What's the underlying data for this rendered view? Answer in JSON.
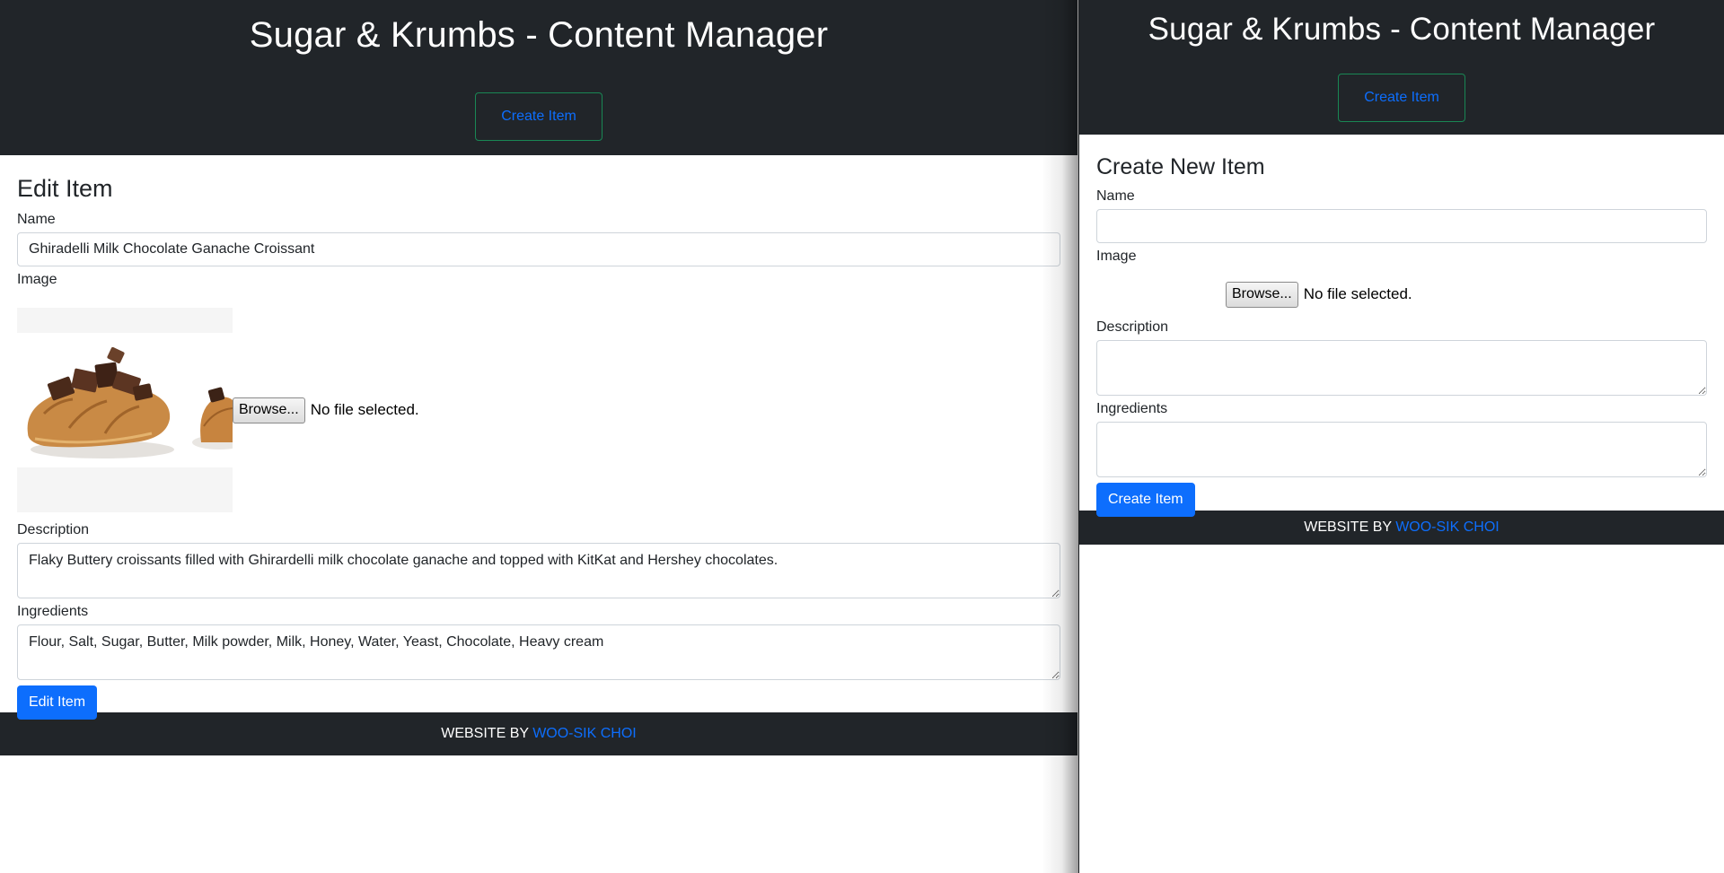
{
  "edit_window": {
    "title": "Sugar & Krumbs - Content Manager",
    "nav_button": "Create Item",
    "heading": "Edit Item",
    "name_label": "Name",
    "name_value": "Ghiradelli Milk Chocolate Ganache Croissant",
    "image_label": "Image",
    "image_description": "Croissant topped with chocolate pieces",
    "browse_label": "Browse...",
    "file_status": "No file selected.",
    "description_label": "Description",
    "description_value": "Flaky Buttery croissants filled with Ghirardelli milk chocolate ganache and topped with KitKat and Hershey chocolates.",
    "ingredients_label": "Ingredients",
    "ingredients_value": "Flour, Salt, Sugar, Butter, Milk powder, Milk, Honey, Water, Yeast, Chocolate, Heavy cream",
    "submit_label": "Edit Item",
    "footer_prefix": "WEBSITE BY",
    "footer_link": "WOO-SIK CHOI"
  },
  "create_window": {
    "title": "Sugar & Krumbs - Content Manager",
    "nav_button": "Create Item",
    "heading": "Create New Item",
    "name_label": "Name",
    "name_value": "",
    "image_label": "Image",
    "browse_label": "Browse...",
    "file_status": "No file selected.",
    "description_label": "Description",
    "description_value": "",
    "ingredients_label": "Ingredients",
    "ingredients_value": "",
    "submit_label": "Create Item",
    "footer_prefix": "WEBSITE BY",
    "footer_link": "WOO-SIK CHOI"
  },
  "colors": {
    "header_bg": "#212529",
    "accent_blue": "#0d6efd",
    "nav_border_green": "#198754"
  },
  "icons": [
    "croissant-image"
  ]
}
